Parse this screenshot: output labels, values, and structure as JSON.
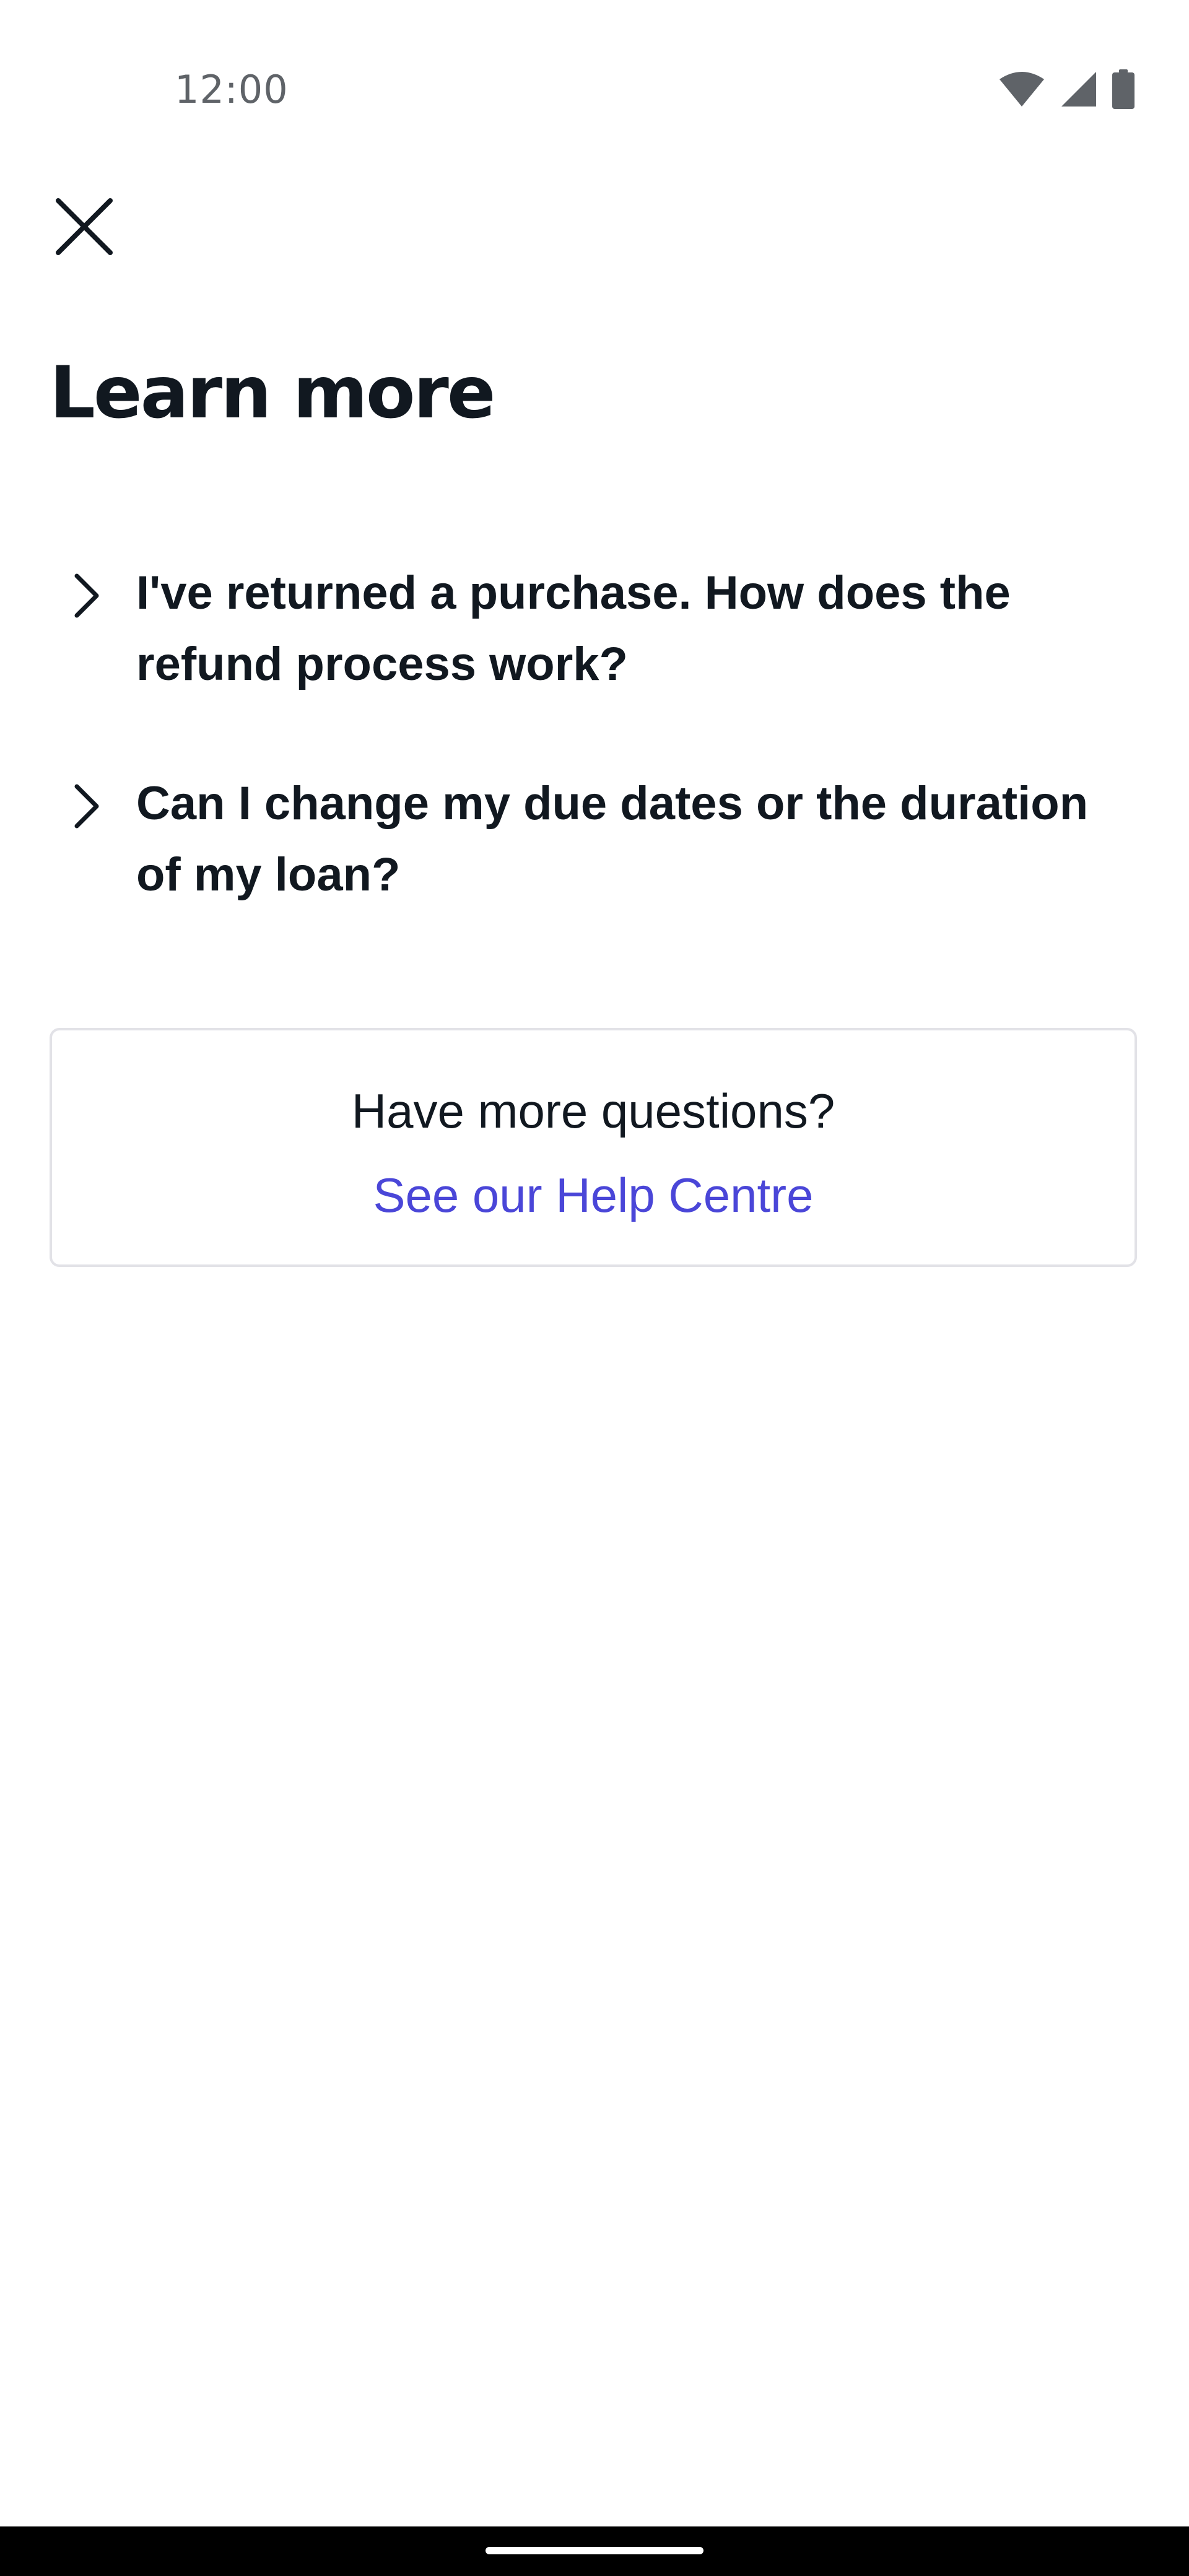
{
  "status_bar": {
    "time": "12:00",
    "icons": [
      "wifi-icon",
      "cellular-signal-icon",
      "battery-icon"
    ]
  },
  "header": {
    "close_icon": "close-icon",
    "title": "Learn more"
  },
  "faq": {
    "items": [
      {
        "question": "I've returned a purchase. How does the refund process work?",
        "icon": "chevron-right-icon"
      },
      {
        "question": "Can I change my due dates or the duration of my loan?",
        "icon": "chevron-right-icon"
      }
    ]
  },
  "help_card": {
    "question": "Have more questions?",
    "link_label": "See our Help Centre"
  },
  "colors": {
    "text_primary": "#111820",
    "link": "#4a46d8",
    "card_border": "#e2e2e7",
    "status_text": "#5f6368"
  }
}
